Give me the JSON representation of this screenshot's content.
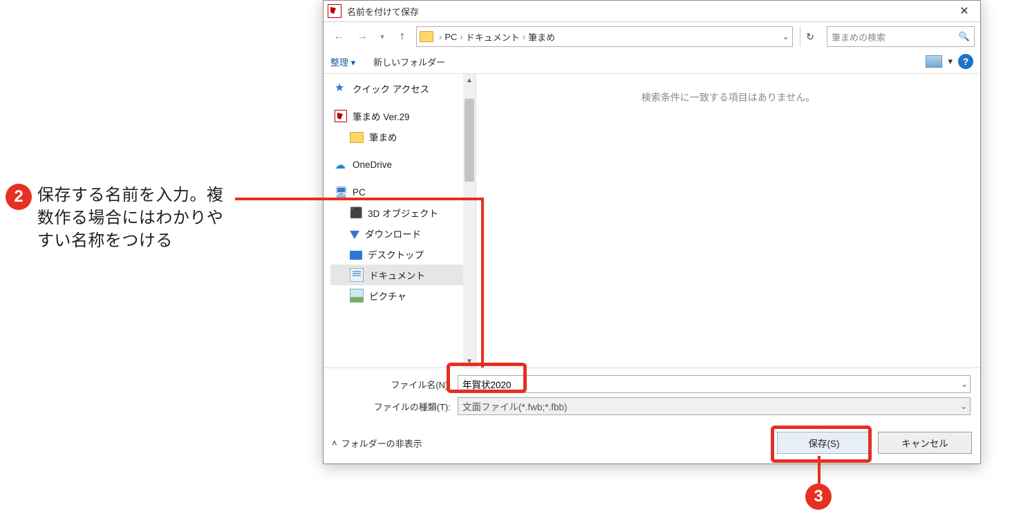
{
  "annotations": {
    "step2_badge": "2",
    "step2_text_line1": "保存する名前を入力。複",
    "step2_text_line2": "数作る場合にはわかりや",
    "step2_text_line3": "すい名称をつける",
    "step3_badge": "3"
  },
  "titlebar": {
    "title": "名前を付けて保存",
    "close_glyph": "✕"
  },
  "nav": {
    "back_glyph": "←",
    "forward_glyph": "→",
    "recent_glyph": "▾",
    "up_glyph": "↑",
    "breadcrumb": {
      "sep": "›",
      "seg1": "PC",
      "seg2": "ドキュメント",
      "seg3": "筆まめ",
      "dropdown_glyph": "⌄"
    },
    "refresh_glyph": "↻",
    "search_placeholder": "筆まめの検索",
    "search_icon": "🔍"
  },
  "toolbar": {
    "organize_label": "整理 ▾",
    "newfolder_label": "新しいフォルダー",
    "view_dd_glyph": "▾",
    "help_glyph": "?"
  },
  "tree": {
    "quick_access": "クイック アクセス",
    "app_item": "筆まめ Ver.29",
    "app_sub": "筆まめ",
    "onedrive": "OneDrive",
    "pc": "PC",
    "obj3d": "3D オブジェクト",
    "download": "ダウンロード",
    "desktop": "デスクトップ",
    "documents": "ドキュメント",
    "pictures": "ピクチャ"
  },
  "filearea": {
    "empty_text": "検索条件に一致する項目はありません。"
  },
  "fields": {
    "filename_label": "ファイル名(N):",
    "filename_value": "年賀状2020",
    "filetype_label": "ファイルの種類(T):",
    "filetype_value": "文面ファイル(*.fwb;*.fbb)",
    "dd_glyph": "⌄"
  },
  "bottom": {
    "hide_label": "フォルダーの非表示",
    "hide_chevron": "˄",
    "save_label": "保存(S)",
    "cancel_label": "キャンセル"
  }
}
